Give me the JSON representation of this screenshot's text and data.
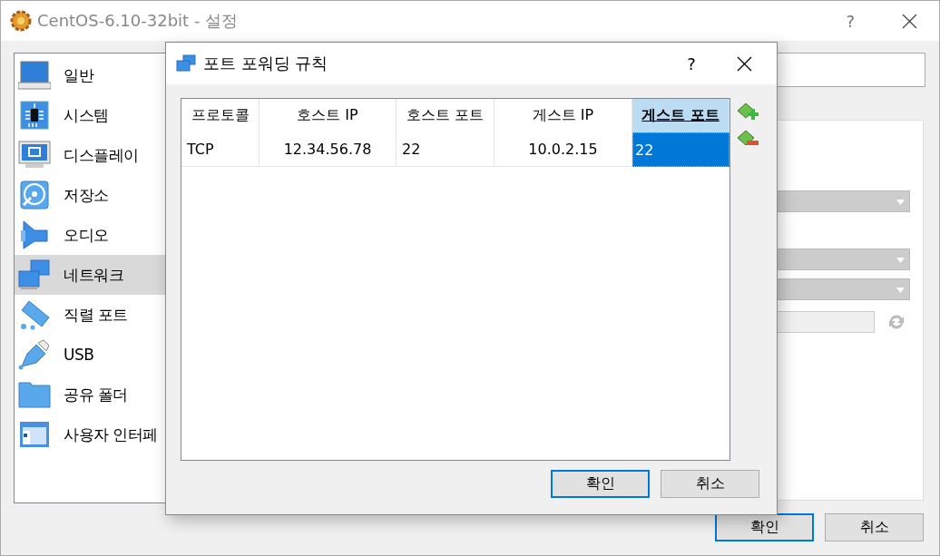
{
  "window": {
    "title": "CentOS-6.10-32bit - 설정",
    "help": "?"
  },
  "sidebar": {
    "items": [
      {
        "label": "일반",
        "kind": "general",
        "selected": false
      },
      {
        "label": "시스템",
        "kind": "system",
        "selected": false
      },
      {
        "label": "디스플레이",
        "kind": "display",
        "selected": false
      },
      {
        "label": "저장소",
        "kind": "storage",
        "selected": false
      },
      {
        "label": "오디오",
        "kind": "audio",
        "selected": false
      },
      {
        "label": "네트워크",
        "kind": "network",
        "selected": true
      },
      {
        "label": "직렬 포트",
        "kind": "serial",
        "selected": false
      },
      {
        "label": "USB",
        "kind": "usb",
        "selected": false
      },
      {
        "label": "공유 폴더",
        "kind": "folder",
        "selected": false
      },
      {
        "label": "사용자 인터페",
        "kind": "ui",
        "selected": false
      }
    ]
  },
  "buttons": [
    {
      "label": "확인",
      "default": true
    },
    {
      "label": "취소",
      "default": false
    }
  ],
  "dialog": {
    "title": "포트 포워딩 규칙",
    "help": "?",
    "table": {
      "columns": [
        {
          "label": "프로토콜",
          "selected": false
        },
        {
          "label": "호스트 IP",
          "selected": false
        },
        {
          "label": "호스트 포트",
          "selected": false
        },
        {
          "label": "게스트 IP",
          "selected": false
        },
        {
          "label": "게스트 포트",
          "selected": true
        }
      ],
      "rows": [
        {
          "cells": [
            {
              "text": "TCP",
              "selected": false
            },
            {
              "text": "12.34.56.78",
              "selected": false
            },
            {
              "text": "22",
              "selected": false
            },
            {
              "text": "10.0.2.15",
              "selected": false
            },
            {
              "text": "22",
              "selected": true
            }
          ]
        }
      ]
    },
    "buttons": [
      {
        "label": "확인",
        "default": true
      },
      {
        "label": "취소",
        "default": false
      }
    ]
  }
}
